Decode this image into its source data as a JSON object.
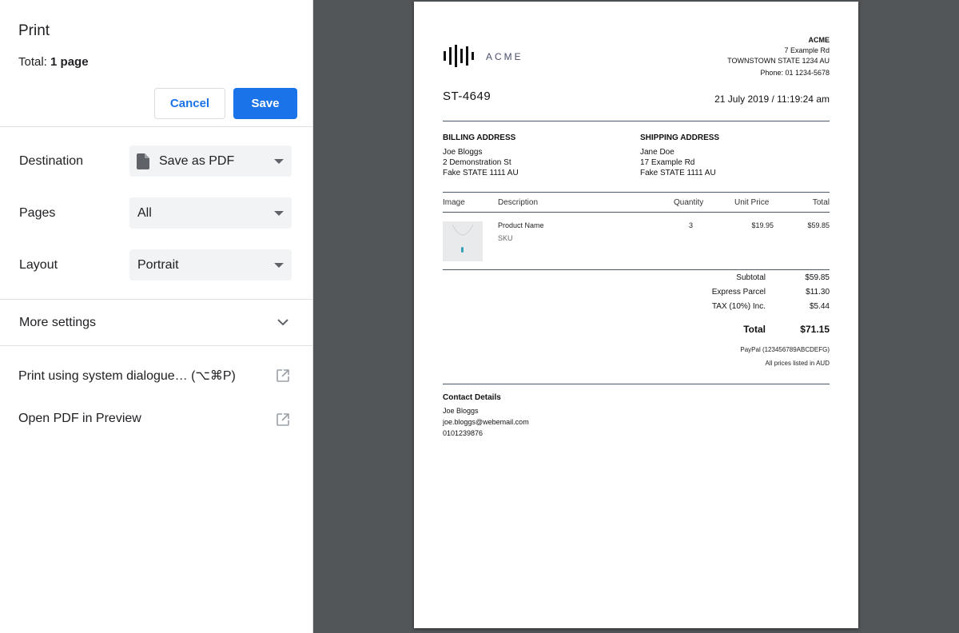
{
  "panel": {
    "title": "Print",
    "total_prefix": "Total: ",
    "total_value": "1 page",
    "cancel_label": "Cancel",
    "save_label": "Save",
    "destination_label": "Destination",
    "destination_value": "Save as PDF",
    "pages_label": "Pages",
    "pages_value": "All",
    "layout_label": "Layout",
    "layout_value": "Portrait",
    "more_settings_label": "More settings",
    "system_dialogue_label": "Print using system dialogue… (⌥⌘P)",
    "open_pdf_label": "Open PDF in Preview",
    "accent_color": "#1a73e8"
  },
  "document": {
    "logo_text": "ACME",
    "company": {
      "name": "ACME",
      "street": "7 Example Rd",
      "city": "TOWNSTOWN STATE 1234 AU",
      "phone": "Phone: 01 1234-5678"
    },
    "order_number": "ST-4649",
    "order_date": "21 July 2019 / 11:19:24 am",
    "billing": {
      "heading": "BILLING ADDRESS",
      "name": "Joe Bloggs",
      "street": "2 Demonstration St",
      "city": "Fake STATE 1111 AU"
    },
    "shipping": {
      "heading": "SHIPPING ADDRESS",
      "name": "Jane Doe",
      "street": "17 Example Rd",
      "city": "Fake STATE 1111 AU"
    },
    "table": {
      "headers": [
        "Image",
        "Description",
        "Quantity",
        "Unit Price",
        "Total"
      ],
      "rows": [
        {
          "product": "Product Name",
          "sku": "SKU",
          "quantity": "3",
          "unit_price": "$19.95",
          "total": "$59.85"
        }
      ]
    },
    "totals": {
      "subtotal_label": "Subtotal",
      "subtotal_value": "$59.85",
      "shipping_label": "Express Parcel",
      "shipping_value": "$11.30",
      "tax_label": "TAX (10%) Inc.",
      "tax_value": "$5.44",
      "grand_label": "Total",
      "grand_value": "$71.15"
    },
    "payment_note": "PayPal (123456789ABCDEFG)",
    "currency_note": "All prices listed in AUD",
    "contact": {
      "heading": "Contact Details",
      "name": "Joe Bloggs",
      "email": "joe.bloggs@webemail.com",
      "phone": "0101239876"
    }
  }
}
